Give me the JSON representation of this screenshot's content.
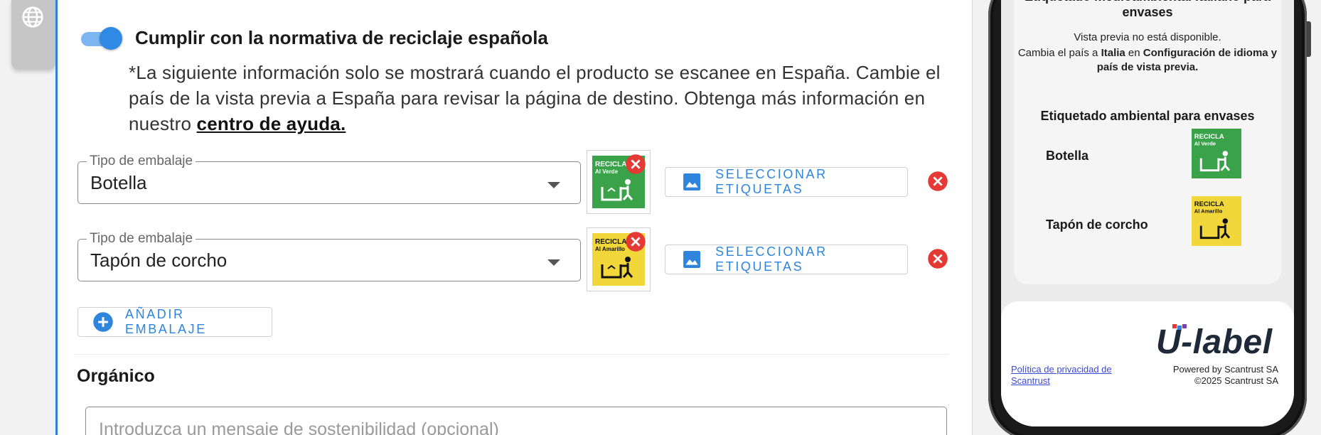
{
  "toggle": {
    "label": "Cumplir con la normativa de reciclaje española",
    "on": true
  },
  "info": {
    "text": "*La siguiente información solo se mostrará cuando el producto se escanee en España. Cambie el país de la vista previa a España para revisar la página de destino. Obtenga más información en nuestro ",
    "link": "centro de ayuda."
  },
  "packaging": [
    {
      "legend": "Tipo de embalaje",
      "value": "Botella",
      "label_color": "green",
      "label_line1": "RECICLA",
      "label_line2": "Al Verde",
      "select_btn": "SELECCIONAR ETIQUETAS"
    },
    {
      "legend": "Tipo de embalaje",
      "value": "Tapón de corcho",
      "label_color": "yellow",
      "label_line1": "RECICLA",
      "label_line2": "Al Amarillo",
      "select_btn": "SELECCIONAR ETIQUETAS"
    }
  ],
  "add_button": "AÑADIR EMBALAJE",
  "organic": {
    "title": "Orgánico",
    "placeholder": "Introduzca un mensaje de sostenibilidad (opcional)"
  },
  "preview": {
    "it_title": "Etiquetado medioambiental italiano para envases",
    "unavailable": "Vista previa no está disponible.",
    "change_prefix": "Cambia el país a ",
    "change_country": "Italia",
    "change_mid": " en ",
    "change_setting": "Configuración de idioma y país de vista previa.",
    "env_title": "Etiquetado ambiental para envases",
    "rows": [
      {
        "name": "Botella",
        "label_color": "green",
        "label_line1": "RECICLA",
        "label_line2": "Al Verde"
      },
      {
        "name": "Tapón de corcho",
        "label_color": "yellow",
        "label_line1": "RECICLA",
        "label_line2": "Al Amarillo"
      }
    ],
    "logo": "U-label",
    "privacy": "Política de privacidad de Scantrust",
    "powered_line1": "Powered by Scantrust SA",
    "powered_line2": "©2025 Scantrust SA"
  },
  "colors": {
    "accent": "#2f85dc",
    "label_green": "#3aa34a",
    "label_yellow": "#f2d73a",
    "remove_red": "#e53935"
  },
  "icons": [
    "globe-icon",
    "image-icon",
    "close-circle-icon",
    "add-circle-icon",
    "dropdown-caret-icon"
  ]
}
